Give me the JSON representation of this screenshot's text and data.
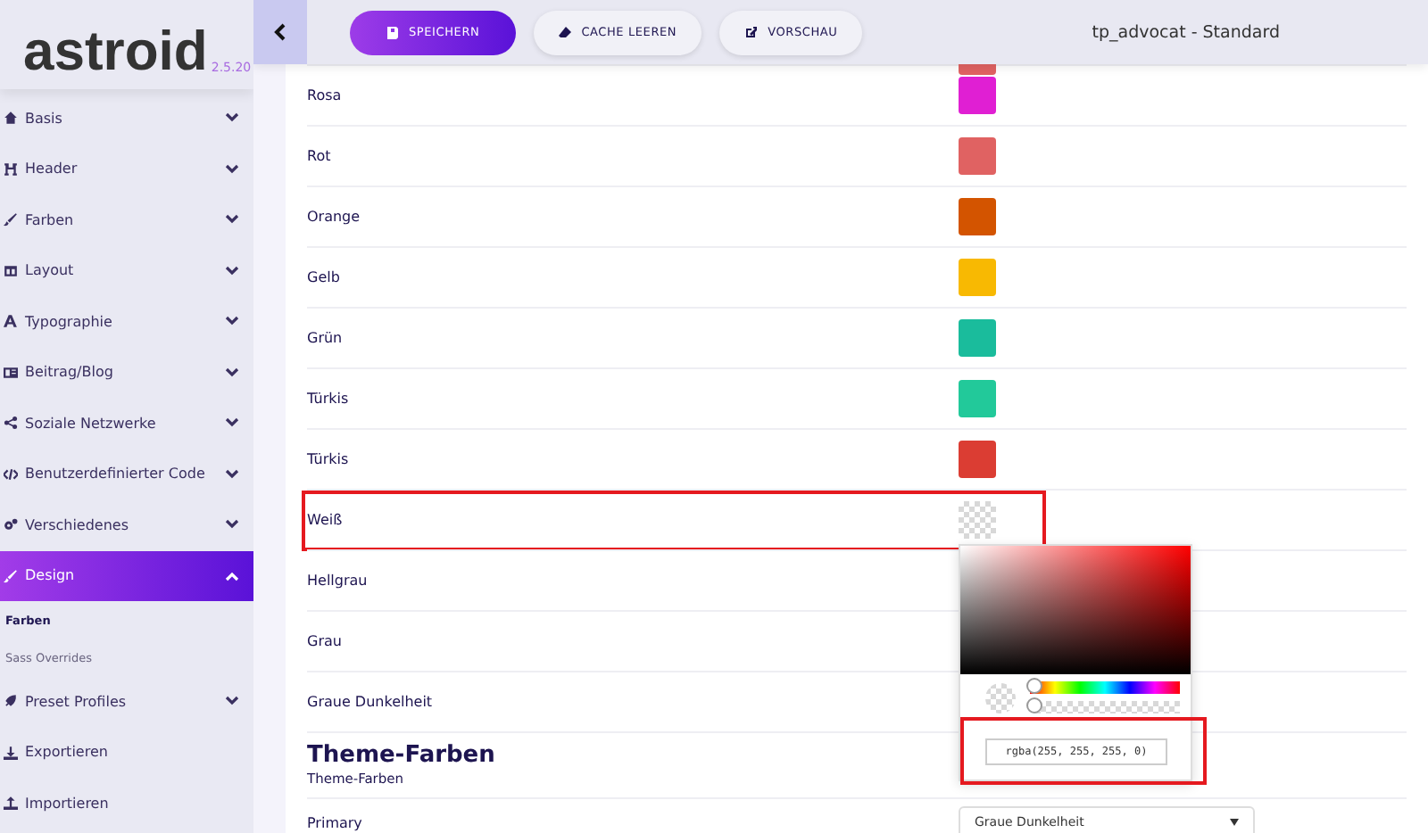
{
  "sidebar": {
    "logo": {
      "name": "astroid",
      "version": "2.5.20"
    },
    "items": [
      {
        "label": "Basis",
        "kind": "group",
        "expanded": false,
        "selected": false
      },
      {
        "label": "Header",
        "kind": "group",
        "expanded": false,
        "selected": false
      },
      {
        "label": "Farben",
        "kind": "group",
        "expanded": false,
        "selected": false
      },
      {
        "label": "Layout",
        "kind": "group",
        "expanded": false,
        "selected": false
      },
      {
        "label": "Typographie",
        "kind": "group",
        "expanded": false,
        "selected": false
      },
      {
        "label": "Beitrag/Blog",
        "kind": "group",
        "expanded": false,
        "selected": false
      },
      {
        "label": "Soziale Netzwerke",
        "kind": "group",
        "expanded": false,
        "selected": false
      },
      {
        "label": "Benutzerdefinierter Code",
        "kind": "group",
        "expanded": false,
        "selected": false
      },
      {
        "label": "Verschiedenes",
        "kind": "group",
        "expanded": false,
        "selected": false
      },
      {
        "label": "Design",
        "kind": "group",
        "expanded": true,
        "selected": true,
        "children": [
          {
            "label": "Farben",
            "selected": true
          },
          {
            "label": "Sass Overrides",
            "selected": false
          }
        ]
      },
      {
        "label": "Preset Profiles",
        "kind": "group",
        "expanded": false,
        "selected": false
      },
      {
        "label": "Exportieren",
        "kind": "link",
        "selected": false
      },
      {
        "label": "Importieren",
        "kind": "link",
        "selected": false
      }
    ]
  },
  "toolbar": {
    "buttons": [
      {
        "label": "SPEICHERN",
        "kind": "primary"
      },
      {
        "label": "CACHE LEEREN",
        "kind": "secondary"
      },
      {
        "label": "VORSCHAU",
        "kind": "secondary"
      }
    ],
    "title": "tp_advocat - Standard"
  },
  "colors": {
    "rows": [
      {
        "kind": "partial",
        "color": "#e06262"
      },
      {
        "kind": "swatch",
        "label": "Rosa",
        "color": "#e01fd3",
        "highlighted": false
      },
      {
        "kind": "swatch",
        "label": "Rot",
        "color": "#e06262",
        "highlighted": false
      },
      {
        "kind": "swatch",
        "label": "Orange",
        "color": "#d35400",
        "highlighted": false
      },
      {
        "kind": "swatch",
        "label": "Gelb",
        "color": "#f8b902",
        "highlighted": false
      },
      {
        "kind": "swatch",
        "label": "Grün",
        "color": "#1abc9c",
        "highlighted": false
      },
      {
        "kind": "swatch",
        "label": "Türkis",
        "color": "#22c99a",
        "highlighted": false
      },
      {
        "kind": "swatch",
        "label": "Türkis",
        "color": "#db3d33",
        "highlighted": false
      },
      {
        "kind": "transparent",
        "label": "Weiß",
        "highlighted": true
      },
      {
        "kind": "covered",
        "label": "Hellgrau",
        "highlighted": false
      },
      {
        "kind": "covered",
        "label": "Grau",
        "highlighted": false
      },
      {
        "kind": "covered",
        "label": "Graue Dunkelheit",
        "highlighted": false
      }
    ]
  },
  "picker": {
    "value": "rgba(255, 255, 255, 0)",
    "highlighted": true,
    "hue_slider": {
      "level": 0
    },
    "alpha_slider": {
      "level": 0
    }
  },
  "theme": {
    "title": "Theme-Farben",
    "subtitle": "Theme-Farben",
    "rows": [
      {
        "label": "Primary",
        "value": "Graue Dunkelheit"
      }
    ]
  }
}
